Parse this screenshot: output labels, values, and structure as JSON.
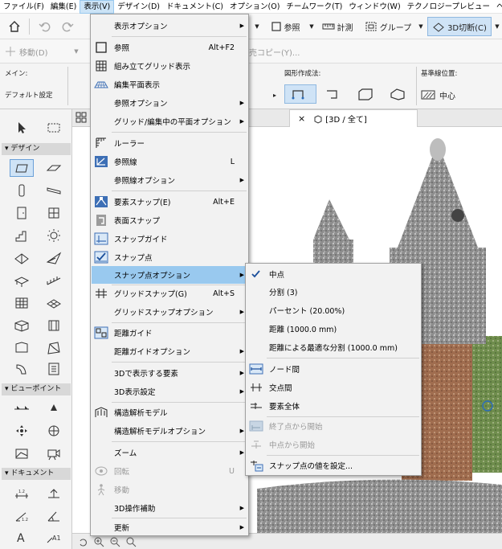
{
  "menubar": {
    "items": [
      "ファイル(F)",
      "編集(E)",
      "表示(V)",
      "デザイン(D)",
      "ドキュメント(C)",
      "オプション(O)",
      "チームワーク(T)",
      "ウィンドウ(W)",
      "テクノロジープレビュー",
      "ヘルプ"
    ]
  },
  "toolbar": {
    "ref_label": "参照",
    "measure_label": "計測",
    "group_label": "グループ",
    "section_label": "3D切断(C)",
    "move_label": "移動(D)",
    "copy_label": "売コピー(Y)..."
  },
  "infobox": {
    "main_label": "メイン:",
    "default_label": "デフォルト設定",
    "shape_label": "図形作成法:",
    "ref_line_label": "基準線位置:",
    "ref_line_value": "中心"
  },
  "toolbox": {
    "design_label": "デザイン",
    "viewpoint_label": "ビューポイント",
    "document_label": "ドキュメント"
  },
  "tab": {
    "title": "[3D / 全て]"
  },
  "view_menu": {
    "items": [
      {
        "label": "表示オプション",
        "shortcut": ""
      },
      {
        "label": "参照",
        "shortcut": "Alt+F2"
      },
      {
        "label": "組み立てグリッド表示",
        "shortcut": ""
      },
      {
        "label": "編集平面表示",
        "shortcut": ""
      },
      {
        "label": "参照オプション",
        "shortcut": ""
      },
      {
        "label": "グリッド/編集中の平面オプション",
        "shortcut": ""
      },
      {
        "label": "ルーラー",
        "shortcut": ""
      },
      {
        "label": "参照線",
        "shortcut": "L"
      },
      {
        "label": "参照線オプション",
        "shortcut": ""
      },
      {
        "label": "要素スナップ(E)",
        "shortcut": "Alt+E"
      },
      {
        "label": "表面スナップ",
        "shortcut": ""
      },
      {
        "label": "スナップガイド",
        "shortcut": ""
      },
      {
        "label": "スナップ点",
        "shortcut": ""
      },
      {
        "label": "スナップ点オプション",
        "shortcut": ""
      },
      {
        "label": "グリッドスナップ(G)",
        "shortcut": "Alt+S"
      },
      {
        "label": "グリッドスナップオプション",
        "shortcut": ""
      },
      {
        "label": "距離ガイド",
        "shortcut": ""
      },
      {
        "label": "距離ガイドオプション",
        "shortcut": ""
      },
      {
        "label": "3Dで表示する要素",
        "shortcut": ""
      },
      {
        "label": "3D表示設定",
        "shortcut": ""
      },
      {
        "label": "構造解析モデル",
        "shortcut": ""
      },
      {
        "label": "構造解析モデルオプション",
        "shortcut": ""
      },
      {
        "label": "ズーム",
        "shortcut": ""
      },
      {
        "label": "回転",
        "shortcut": "U"
      },
      {
        "label": "移動",
        "shortcut": ""
      },
      {
        "label": "3D操作補助",
        "shortcut": ""
      },
      {
        "label": "更新",
        "shortcut": ""
      }
    ]
  },
  "snap_submenu": {
    "items": [
      {
        "label": "中点"
      },
      {
        "label": "分割 (3)"
      },
      {
        "label": "パーセント (20.00%)"
      },
      {
        "label": "距離 (1000.0 mm)"
      },
      {
        "label": "距離による最適な分割 (1000.0 mm)"
      },
      {
        "label": "ノード間"
      },
      {
        "label": "交点間"
      },
      {
        "label": "要素全体"
      },
      {
        "label": "終了点から開始"
      },
      {
        "label": "中点から開始"
      },
      {
        "label": "スナップ点の値を設定..."
      }
    ]
  },
  "colors": {
    "highlight": "#99c9ef",
    "accent": "#2b6cb8"
  }
}
